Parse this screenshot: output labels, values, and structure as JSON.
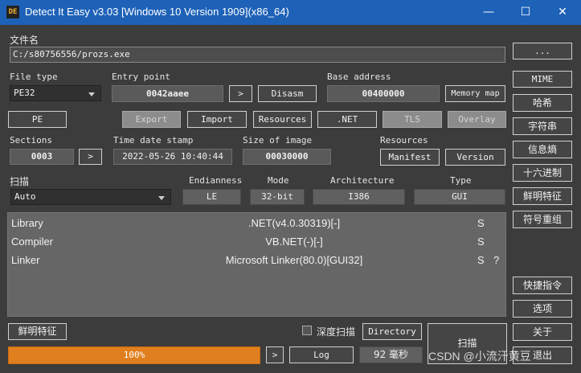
{
  "window": {
    "title": "Detect It Easy v3.03 [Windows 10 Version 1909](x86_64)",
    "app_icon_text": "DE",
    "icons": {
      "minimize": "minimize-icon",
      "maximize": "maximize-icon",
      "close": "close-icon"
    }
  },
  "file": {
    "label": "文件名",
    "path": "C:/s80756556/prozs.exe",
    "browse_label": "..."
  },
  "file_type": {
    "label": "File type",
    "value": "PE32",
    "pe_button": "PE"
  },
  "entry_point": {
    "label": "Entry point",
    "value": "0042aaee",
    "go": ">",
    "disasm": "Disasm"
  },
  "base_address": {
    "label": "Base address",
    "value": "00400000",
    "memory_map": "Memory map"
  },
  "sections_buttons": {
    "export": "Export",
    "import": "Import",
    "resources": "Resources",
    "dotnet": ".NET",
    "tls": "TLS",
    "overlay": "Overlay"
  },
  "sections": {
    "label": "Sections",
    "value": "0003",
    "go": ">"
  },
  "timestamp": {
    "label": "Time date stamp",
    "value": "2022-05-26 10:40:44"
  },
  "size_of_image": {
    "label": "Size of image",
    "value": "00030000"
  },
  "resources": {
    "label": "Resources",
    "manifest": "Manifest",
    "version": "Version"
  },
  "scan_options": {
    "label": "扫描",
    "mode_value": "Auto",
    "endianness_label": "Endianness",
    "endianness": "LE",
    "mode_label": "Mode",
    "mode": "32-bit",
    "architecture_label": "Architecture",
    "architecture": "I386",
    "type_label": "Type",
    "type": "GUI"
  },
  "results": [
    {
      "type": "Library",
      "name": ".NET(v4.0.30319)[-]",
      "flag": "S",
      "extra": ""
    },
    {
      "type": "Compiler",
      "name": "VB.NET(-)[-]",
      "flag": "S",
      "extra": ""
    },
    {
      "type": "Linker",
      "name": "Microsoft Linker(80.0)[GUI32]",
      "flag": "S",
      "extra": "?"
    }
  ],
  "side_buttons": {
    "mime": "MIME",
    "hash": "哈希",
    "strings": "字符串",
    "entropy": "信息熵",
    "hex": "十六进制",
    "signatures": "鲜明特征",
    "symbols": "符号重组",
    "shortcuts": "快捷指令",
    "options": "选项",
    "about": "关于",
    "exit": "退出"
  },
  "bottom": {
    "signatures_button": "鲜明特征",
    "deep_scan_label": "深度扫描",
    "directory": "Directory",
    "scan": "扫描",
    "progress_text": "100%",
    "progress_fraction": 1.0,
    "go": ">",
    "log": "Log",
    "time": "92 毫秒"
  },
  "watermark": "CSDN @小流汗黄豆",
  "colors": {
    "titlebar": "#1e62b8",
    "background": "#3c3c3c",
    "progress": "#e07f1e",
    "results_bg": "#666666"
  }
}
